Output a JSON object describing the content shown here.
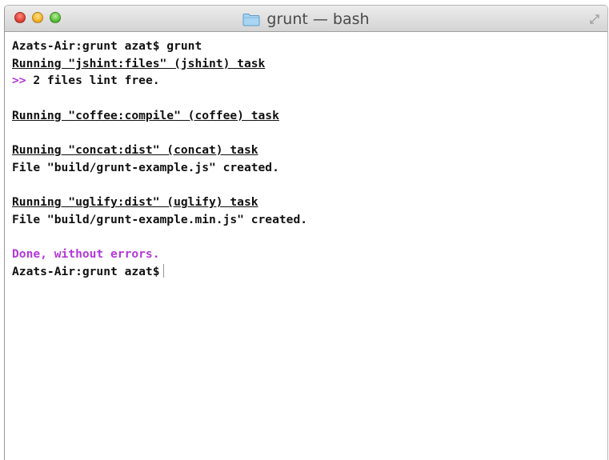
{
  "window": {
    "title": "grunt — bash",
    "title_icon": "folder-icon",
    "controls": [
      "close-button",
      "minimize-button",
      "zoom-button"
    ]
  },
  "colors": {
    "text": "#111111",
    "accent_magenta": "#b338d8",
    "titlebar": "#dcdcdc"
  },
  "terminal": {
    "lines": [
      {
        "text": "Azats-Air:grunt azat$ grunt"
      },
      {
        "text": "Running \"jshint:files\" (jshint) task"
      },
      {
        "prefix": ">>",
        "text": " 2 files lint free."
      },
      {
        "text": ""
      },
      {
        "text": "Running \"coffee:compile\" (coffee) task"
      },
      {
        "text": ""
      },
      {
        "text": "Running \"concat:dist\" (concat) task"
      },
      {
        "text": "File \"build/grunt-example.js\" created."
      },
      {
        "text": ""
      },
      {
        "text": "Running \"uglify:dist\" (uglify) task"
      },
      {
        "text": "File \"build/grunt-example.min.js\" created."
      },
      {
        "text": ""
      },
      {
        "text": "Done, without errors."
      },
      {
        "text": "Azats-Air:grunt azat$"
      }
    ]
  }
}
